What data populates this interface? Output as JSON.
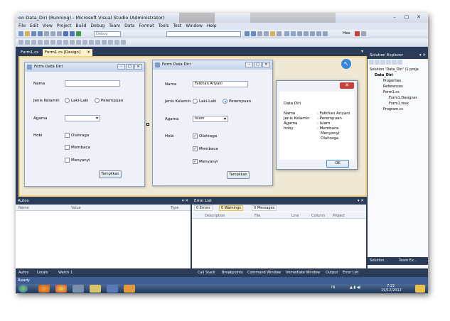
{
  "window": {
    "title": "on Data_Diri (Running) - Microsoft Visual Studio (Administrator)",
    "controls": [
      "–",
      "□",
      "✕"
    ]
  },
  "menu": [
    "File",
    "Edit",
    "View",
    "Project",
    "Build",
    "Debug",
    "Team",
    "Data",
    "Format",
    "Tools",
    "Test",
    "Window",
    "Help"
  ],
  "toolbar": {
    "config": "Debug",
    "hex_label": "Hex"
  },
  "doc_tabs": [
    {
      "label": "Form1.cs",
      "active": false
    },
    {
      "label": "Form1.cs [Design]",
      "active": true
    }
  ],
  "doc_tab_close": "✕",
  "design_form": {
    "title": "Form Data Diri",
    "labels": {
      "nama": "Nama",
      "jenis_kelamin": "Jenis Kelamin",
      "agama": "Agama",
      "hobi": "Hobi"
    },
    "radio_laki": "Laki-Laki",
    "radio_perempuan": "Perempuan",
    "hobi_options": [
      "Olahraga",
      "Membaca",
      "Menyanyi"
    ],
    "button": "Tampilkan"
  },
  "running_form": {
    "title": "Form Data Diri",
    "labels": {
      "nama": "Nama",
      "jenis_kelamin": "Jenis Kelamin",
      "agama": "Agama",
      "hobi": "Hobi"
    },
    "nama_value": "Fatkhan Ariyani",
    "radio_laki": "Laki-Laki",
    "radio_perempuan": "Perempuan",
    "agama_value": "Islam",
    "hobi_options": [
      "Olahraga",
      "Membaca",
      "Menyanyi"
    ],
    "hobi_checked": [
      true,
      true,
      true
    ],
    "button": "Tampilkan"
  },
  "message_box": {
    "heading": "Data Diri",
    "rows": [
      {
        "label": "Nama",
        "value": ": Fatkhan Ariyani"
      },
      {
        "label": "Jenis Kelamin",
        "value": ": Perempuan"
      },
      {
        "label": "Agama",
        "value": ": Islam"
      },
      {
        "label": "hoby",
        "value": ": Membaca"
      }
    ],
    "extra_lines": [
      "Menyanyi",
      "Olahraga"
    ],
    "ok": "OK",
    "close": "✕"
  },
  "solution_explorer": {
    "title": "Solution Explorer",
    "header_controls": "▾ ✕",
    "nodes": [
      "Solution 'Data_Diri' (1 proje",
      "Data_Diri",
      "Properties",
      "References",
      "Form1.cs",
      "Form1.Designer.",
      "Form1.resx",
      "Program.cs"
    ],
    "tabs": [
      "Solution...",
      "Team Ex..."
    ]
  },
  "autos": {
    "title": "Autos",
    "header_controls": "▾ ✕",
    "columns": [
      "Name",
      "Value",
      "Type"
    ]
  },
  "error_list": {
    "title": "Error List",
    "header_controls": "▾ ✕",
    "filters": [
      "0 Errors",
      "0 Warnings",
      "0 Messages"
    ],
    "columns": [
      "Description",
      "File",
      "Line",
      "Column",
      "Project"
    ]
  },
  "bottom_tabs_left": [
    "Autos",
    "Locals",
    "Watch 1"
  ],
  "bottom_tabs_right": [
    "Call Stack",
    "Breakpoints",
    "Command Window",
    "Immediate Window",
    "Output",
    "Error List"
  ],
  "status": "Ready",
  "taskbar": {
    "lang": "IN",
    "time": "7:22",
    "date": "19/12/2012"
  },
  "colors": {
    "ide_dark": "#2b3c59",
    "designer_bg": "#eee8d5",
    "active_tab": "#fdf1c9",
    "statusbar": "#3e5e92",
    "close_red": "#c8423a"
  }
}
